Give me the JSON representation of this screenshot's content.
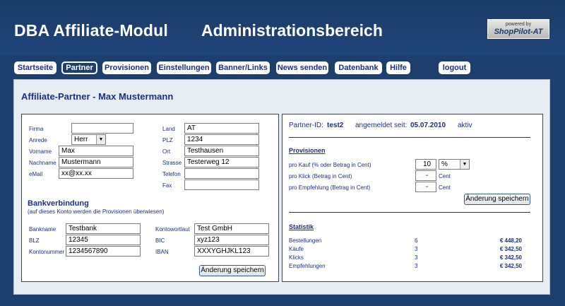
{
  "header": {
    "title_left": "DBA Affiliate-Modul",
    "title_right": "Administrationsbereich",
    "logo_small": "powered by",
    "logo_big": "ShopPilot-AT"
  },
  "nav": {
    "startseite": "Startseite",
    "partner": "Partner",
    "provisionen": "Provisionen",
    "einstellungen": "Einstellungen",
    "banner": "Banner/Links",
    "news": "News senden",
    "datenbank": "Datenbank",
    "hilfe": "Hilfe",
    "logout": "logout"
  },
  "page": {
    "title": "Affiliate-Partner - Max Mustermann"
  },
  "partner_form": {
    "firma_label": "Firma",
    "firma_value": "",
    "anrede_label": "Anrede",
    "anrede_value": "Herr",
    "vorname_label": "Vorname",
    "vorname_value": "Max",
    "nachname_label": "Nachname",
    "nachname_value": "Mustermann",
    "email_label": "eMail",
    "email_value": "xx@xx.xx",
    "land_label": "Land",
    "land_value": "AT",
    "plz_label": "PLZ",
    "plz_value": "1234",
    "ort_label": "Ort",
    "ort_value": "Testhausen",
    "strasse_label": "Strasse",
    "strasse_value": "Testerweg 12",
    "telefon_label": "Telefon",
    "telefon_value": "",
    "fax_label": "Fax",
    "fax_value": ""
  },
  "bank": {
    "heading": "Bankverbindung",
    "subheading": "(auf dieses Konto werden die Provisionen überwiesen)",
    "bankname_label": "Bankname",
    "bankname_value": "Testbank",
    "blz_label": "BLZ",
    "blz_value": "12345",
    "kontonummer_label": "Kontonummer",
    "kontonummer_value": "1234567890",
    "kontowortlaut_label": "Kontowortlaut",
    "kontowortlaut_value": "Test GmbH",
    "bic_label": "BIC",
    "bic_value": "xyz123",
    "iban_label": "IBAN",
    "iban_value": "XXXYGHJKL123",
    "save_label": "Änderung speichern"
  },
  "partner_info": {
    "id_label": "Partner-ID:",
    "id_value": "test2",
    "since_label": "angemeldet seit:",
    "since_value": "05.07.2010",
    "status": "aktiv"
  },
  "provisionen": {
    "heading": "Provisionen",
    "kauf_label": "pro Kauf (% oder Betrag in Cent)",
    "kauf_value": "10",
    "kauf_unit": "%",
    "klick_label": "pro Klick (Betrag in Cent)",
    "klick_value": "-",
    "klick_unit": "Cent",
    "empfehlung_label": "pro Empfehlung (Betrag in Cent)",
    "empfehlung_value": "-",
    "empfehlung_unit": "Cent",
    "save_label": "Änderung speichern"
  },
  "statistik": {
    "heading": "Statistik",
    "rows": [
      {
        "label": "Bestellungen",
        "count": "6",
        "amount": "€ 448,20"
      },
      {
        "label": "Käufe",
        "count": "3",
        "amount": "€ 342,50"
      },
      {
        "label": "Klicks",
        "count": "3",
        "amount": "€ 342,50"
      },
      {
        "label": "Empfehlungen",
        "count": "3",
        "amount": "€ 342,50"
      }
    ]
  }
}
